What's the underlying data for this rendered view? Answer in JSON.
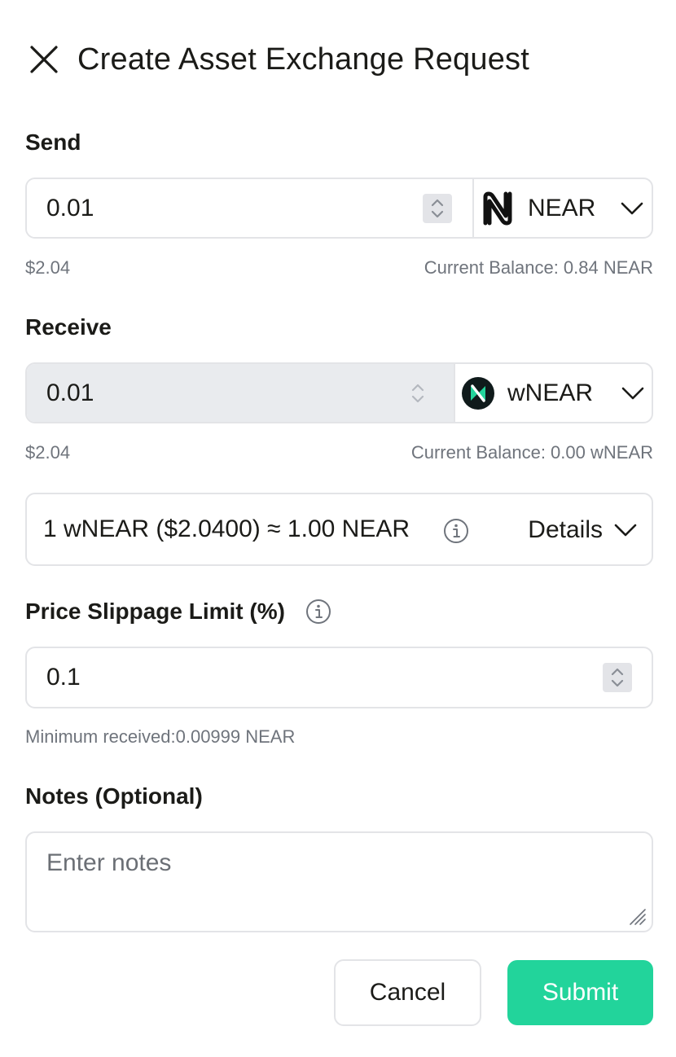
{
  "header": {
    "title": "Create Asset Exchange Request"
  },
  "send": {
    "label": "Send",
    "amount": "0.01",
    "token": "NEAR",
    "usd_value": "$2.04",
    "balance": "Current Balance: 0.84 NEAR"
  },
  "receive": {
    "label": "Receive",
    "amount": "0.01",
    "token": "wNEAR",
    "usd_value": "$2.04",
    "balance": "Current Balance: 0.00 wNEAR"
  },
  "rate": {
    "text": "1 wNEAR ($2.0400) ≈ 1.00 NEAR",
    "details_label": "Details"
  },
  "slippage": {
    "label": "Price Slippage Limit (%)",
    "value": "0.1",
    "minimum_received": "Minimum received:0.00999 NEAR"
  },
  "notes": {
    "label": "Notes (Optional)",
    "placeholder": "Enter notes"
  },
  "actions": {
    "cancel_label": "Cancel",
    "submit_label": "Submit"
  },
  "colors": {
    "accent": "#22d49b",
    "border": "#e3e4e7",
    "muted_text": "#6f747c",
    "disabled_bg": "#e9ebee"
  }
}
